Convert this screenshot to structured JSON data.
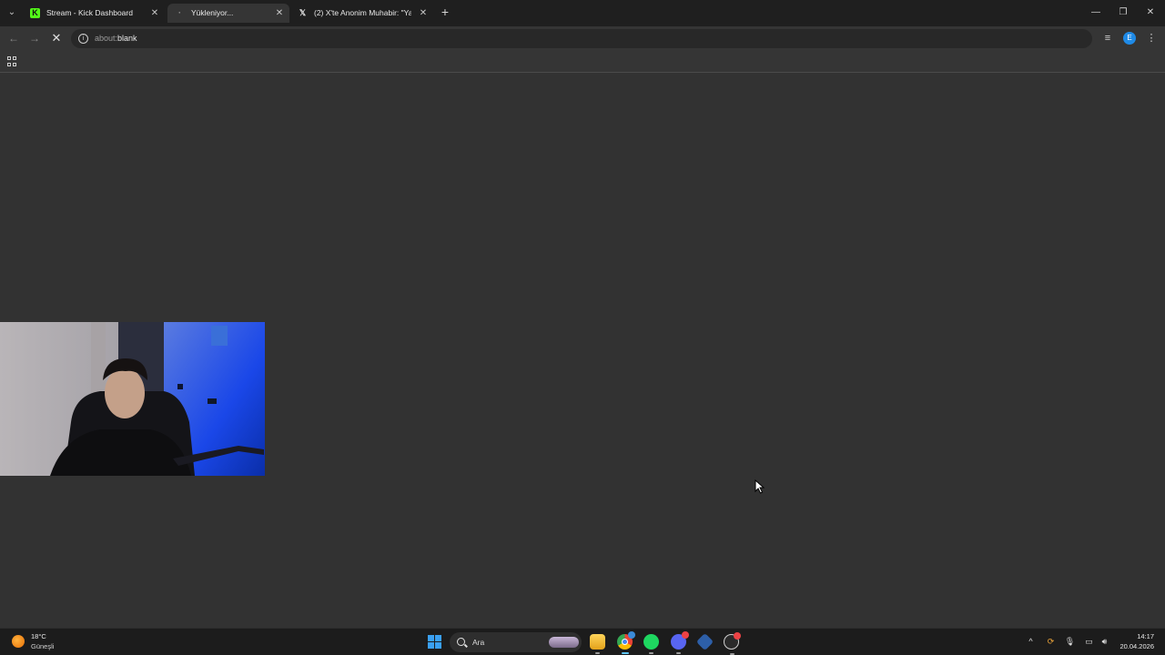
{
  "browser": {
    "tabs": [
      {
        "title": "Stream - Kick Dashboard",
        "icon": "kick-logo-icon",
        "active": false
      },
      {
        "title": "Yükleniyor...",
        "icon": "loading-icon",
        "active": true
      },
      {
        "title": "(2) X'te Anonim Muhabir: \"Yakın",
        "icon": "x-logo-icon",
        "active": false
      }
    ],
    "address": {
      "scheme": "about:",
      "path": "blank"
    },
    "profile_initial": "E",
    "page_loading": true
  },
  "taskbar": {
    "weather": {
      "temp": "18°C",
      "desc": "Güneşli"
    },
    "search_label": "Ara",
    "clock": {
      "time": "14:17",
      "date": "20.04.2026"
    },
    "apps": [
      "file-explorer-icon",
      "chrome-icon",
      "spotify-icon",
      "discord-icon",
      "app-icon",
      "steam-icon"
    ]
  },
  "colors": {
    "accent": "#60c7ff",
    "kick": "#53fc18",
    "profile": "#1f8ae6"
  }
}
